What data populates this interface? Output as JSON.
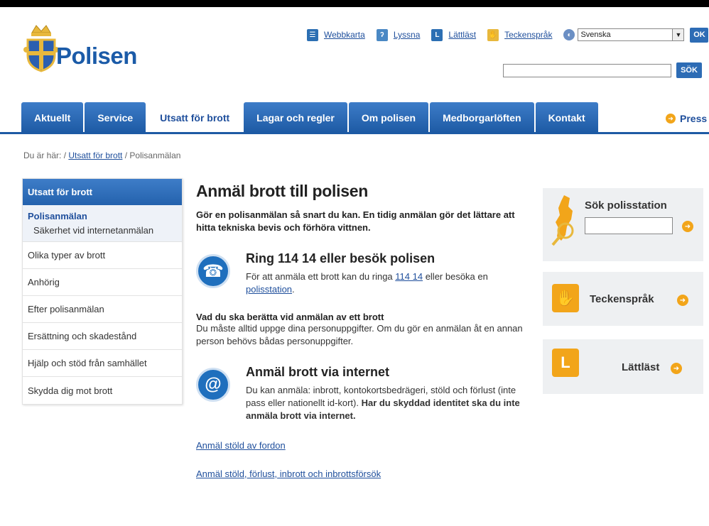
{
  "brand": {
    "logo_text": "Polisen"
  },
  "toolbar": {
    "links": [
      {
        "label": "Webbkarta",
        "icon": "sitemap-icon"
      },
      {
        "label": "Lyssna",
        "icon": "listen-icon"
      },
      {
        "label": "Lättläst",
        "icon": "easy-read-icon"
      },
      {
        "label": "Teckenspråk",
        "icon": "sign-language-icon"
      }
    ],
    "language_value": "Svenska",
    "ok_label": "OK"
  },
  "search": {
    "button_label": "SÖK",
    "value": ""
  },
  "nav": {
    "tabs": [
      "Aktuellt",
      "Service",
      "Utsatt för brott",
      "Lagar och regler",
      "Om polisen",
      "Medborgarlöften",
      "Kontakt"
    ],
    "active_index": 2,
    "press_label": "Press"
  },
  "breadcrumb": {
    "prefix": "Du är här: / ",
    "link": "Utsatt för brott",
    "current": " / Polisanmälan"
  },
  "sidebar": {
    "header": "Utsatt för brott",
    "selected": {
      "title": "Polisanmälan",
      "sub": "Säkerhet vid internetanmälan"
    },
    "items": [
      "Olika typer av brott",
      "Anhörig",
      "Efter polisanmälan",
      "Ersättning och skadestånd",
      "Hjälp och stöd från samhället",
      "Skydda dig mot brott"
    ]
  },
  "main": {
    "title": "Anmäl brott till polisen",
    "lead": "Gör en polisanmälan så snart du kan. En tidig anmälan gör det lättare att hitta tekniska bevis och förhöra vittnen.",
    "call": {
      "heading": "Ring 114 14 eller besök polisen",
      "text_before": "För att anmäla ett brott kan du ringa ",
      "phone_link": "114 14",
      "text_middle": " eller besöka en ",
      "station_link": "polisstation",
      "text_after": "."
    },
    "info": {
      "heading": "Vad du ska berätta vid anmälan av ett brott",
      "text": "Du måste alltid uppge dina personuppgifter. Om du gör en anmälan åt en annan person behövs bådas personuppgifter."
    },
    "internet": {
      "heading": "Anmäl brott via internet",
      "text": "Du kan anmäla: inbrott, kontokortsbedrägeri, stöld och förlust (inte pass eller nationellt id-kort). ",
      "bold": "Har du skyddad identitet ska du inte anmäla brott via internet."
    },
    "links": [
      "Anmäl stöld av fordon",
      "Anmäl stöld, förlust, inbrott och inbrottsförsök"
    ]
  },
  "right": {
    "station_title": "Sök polisstation",
    "sign_label": "Teckenspråk",
    "easy_label": "Lättläst"
  }
}
